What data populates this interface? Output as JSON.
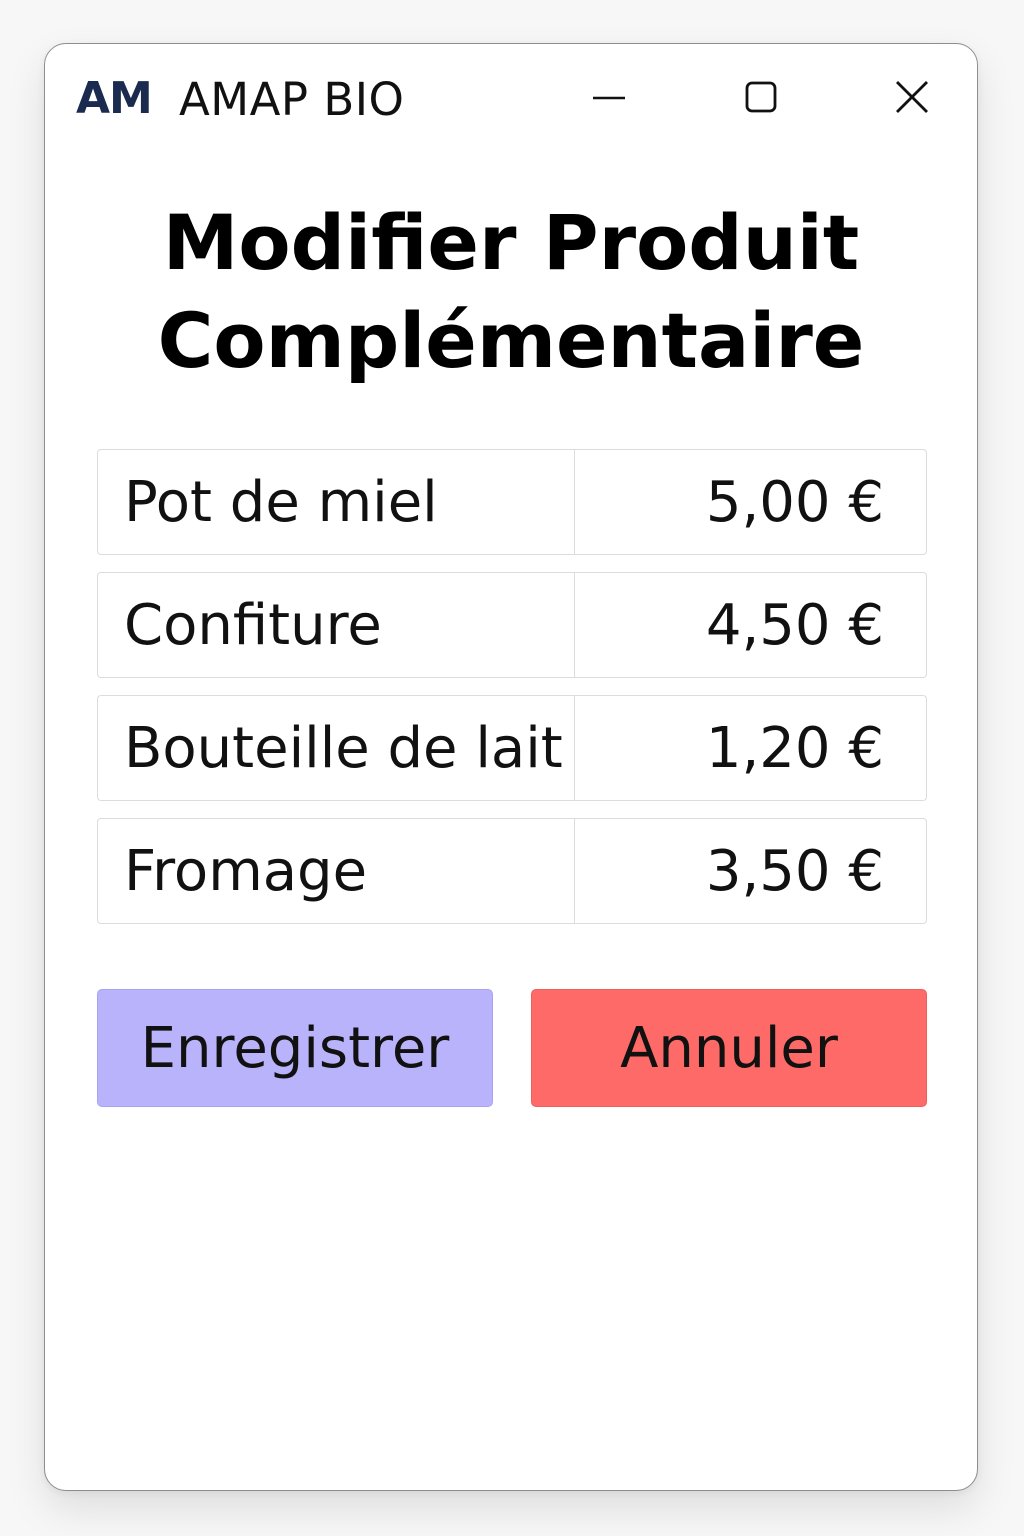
{
  "window": {
    "logo_text": "AM",
    "title": "AMAP BIO",
    "controls": [
      "minimize-icon",
      "maximize-icon",
      "close-icon"
    ]
  },
  "heading": {
    "line1": "Modifier Produit",
    "line2": "Complémentaire"
  },
  "products": [
    {
      "name": "Pot de miel",
      "price": "5,00 €"
    },
    {
      "name": "Confiture",
      "price": "4,50 €"
    },
    {
      "name": "Bouteille de lait",
      "price": "1,20 €"
    },
    {
      "name": "Fromage",
      "price": "3,50 €"
    }
  ],
  "actions": {
    "save_label": "Enregistrer",
    "cancel_label": "Annuler"
  },
  "colors": {
    "logo": "#1a2b4f",
    "save_button": "#b9b3fb",
    "cancel_button": "#fd6a67"
  }
}
